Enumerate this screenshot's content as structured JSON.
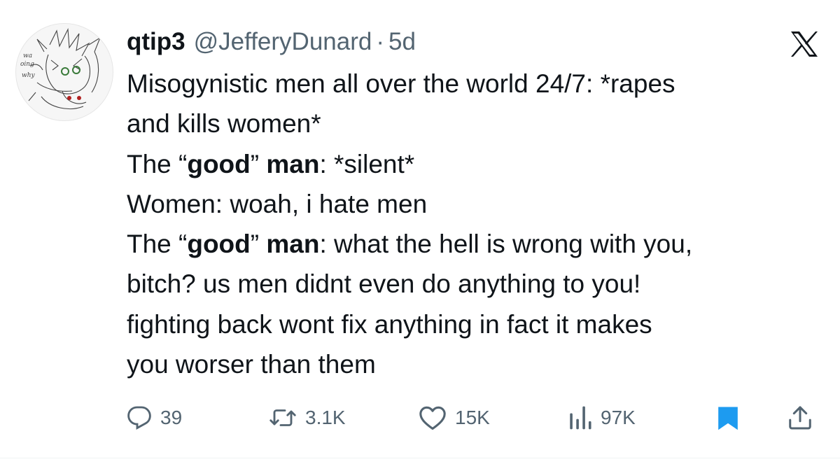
{
  "tweet": {
    "display_name": "qtip3",
    "handle": "@JefferyDunard",
    "separator": "·",
    "time": "5d",
    "text_lines": [
      [
        {
          "t": "Misogynistic men all over the world 24/7: *rapes",
          "b": false
        }
      ],
      [
        {
          "t": "and kills women*",
          "b": false
        }
      ],
      [
        {
          "t": "The “",
          "b": false
        },
        {
          "t": "good",
          "b": true
        },
        {
          "t": "” ",
          "b": false
        },
        {
          "t": "man",
          "b": true
        },
        {
          "t": ": *silent*",
          "b": false
        }
      ],
      [
        {
          "t": "Women: woah, i hate men",
          "b": false
        }
      ],
      [
        {
          "t": "The “",
          "b": false
        },
        {
          "t": "good",
          "b": true
        },
        {
          "t": "” ",
          "b": false
        },
        {
          "t": "man",
          "b": true
        },
        {
          "t": ": what the hell is wrong with you,",
          "b": false
        }
      ],
      [
        {
          "t": "bitch? us men didnt even do anything to you!",
          "b": false
        }
      ],
      [
        {
          "t": "fighting back wont fix anything in fact it makes",
          "b": false
        }
      ],
      [
        {
          "t": "you worser than them",
          "b": false
        }
      ]
    ]
  },
  "actions": {
    "replies": "39",
    "reposts": "3.1K",
    "likes": "15K",
    "views": "97K"
  },
  "icons": {
    "avatar": "avatar-sketch",
    "brand": "x-logo-icon",
    "reply": "reply-icon",
    "repost": "repost-icon",
    "like": "heart-icon",
    "views": "views-icon",
    "bookmark": "bookmark-icon",
    "share": "share-icon"
  },
  "colors": {
    "text": "#0f1419",
    "secondary": "#536471",
    "bookmark_active": "#1d9bf0",
    "accent_blue": "#1d9bf0"
  }
}
